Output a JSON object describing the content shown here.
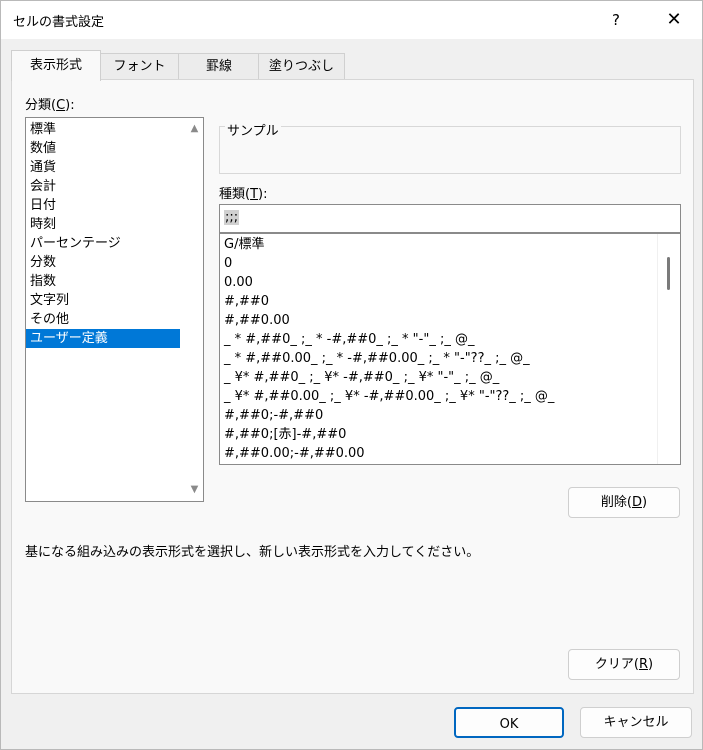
{
  "window": {
    "title": "セルの書式設定",
    "help_icon": "?",
    "close_icon": "✕"
  },
  "tabs": [
    {
      "label": "表示形式",
      "active": true
    },
    {
      "label": "フォント",
      "active": false
    },
    {
      "label": "罫線",
      "active": false
    },
    {
      "label": "塗りつぶし",
      "active": false
    }
  ],
  "category": {
    "label_text": "分類(",
    "label_accel": "C",
    "label_tail": "):",
    "items": [
      "標準",
      "数値",
      "通貨",
      "会計",
      "日付",
      "時刻",
      "パーセンテージ",
      "分数",
      "指数",
      "文字列",
      "その他",
      "ユーザー定義"
    ],
    "selected_index": 11
  },
  "sample": {
    "label": "サンプル"
  },
  "type": {
    "label_text": "種類(",
    "label_accel": "T",
    "label_tail": "):",
    "value": ";;;",
    "formats": [
      "G/標準",
      "0",
      "0.00",
      "#,##0",
      "#,##0.00",
      "_ * #,##0_ ;_ * -#,##0_ ;_ * \"-\"_ ;_ @_",
      "_ * #,##0.00_ ;_ * -#,##0.00_ ;_ * \"-\"??_ ;_ @_",
      "_ ¥* #,##0_ ;_ ¥* -#,##0_ ;_ ¥* \"-\"_ ;_ @_",
      "_ ¥* #,##0.00_ ;_ ¥* -#,##0.00_ ;_ ¥* \"-\"??_ ;_ @_",
      "#,##0;-#,##0",
      "#,##0;[赤]-#,##0",
      "#,##0.00;-#,##0.00"
    ]
  },
  "buttons": {
    "delete_text": "削除(",
    "delete_accel": "D",
    "delete_tail": ")",
    "clear_text": "クリア(",
    "clear_accel": "R",
    "clear_tail": ")",
    "ok": "OK",
    "cancel": "キャンセル"
  },
  "description": "基になる組み込みの表示形式を選択し、新しい表示形式を入力してください。",
  "colors": {
    "selection": "#0078d7",
    "ok_border": "#0067c0",
    "background": "#f0f0f0"
  }
}
